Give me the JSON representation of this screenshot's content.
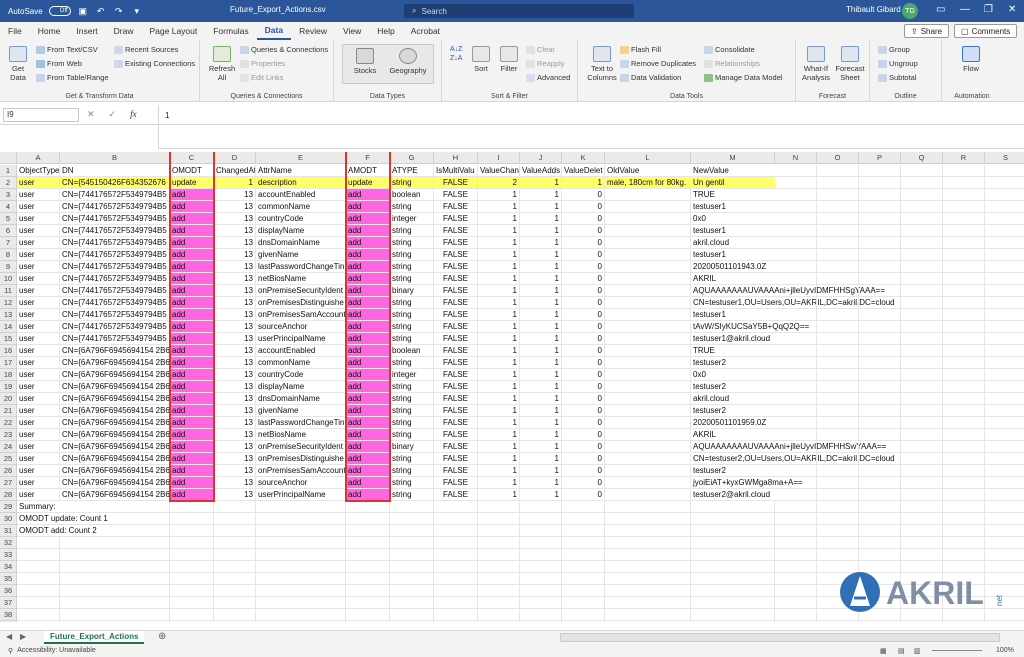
{
  "titlebar": {
    "autosave_label": "AutoSave",
    "autosave_state": "Off",
    "filename": "Future_Export_Actions.csv",
    "search_placeholder": "Search",
    "user_name": "Thibault Gibard",
    "user_initials": "TG"
  },
  "tabs": [
    "File",
    "Home",
    "Insert",
    "Draw",
    "Page Layout",
    "Formulas",
    "Data",
    "Review",
    "View",
    "Help",
    "Acrobat"
  ],
  "active_tab": "Data",
  "share_label": "Share",
  "comments_label": "Comments",
  "ribbon": {
    "get_data": "Get\nData",
    "from_text": "From Text/CSV",
    "from_web": "From Web",
    "from_table": "From Table/Range",
    "recent_sources": "Recent Sources",
    "existing_connections": "Existing Connections",
    "group1_label": "Get & Transform Data",
    "refresh_all": "Refresh\nAll",
    "queries_connections": "Queries & Connections",
    "properties": "Properties",
    "edit_links": "Edit Links",
    "group2_label": "Queries & Connections",
    "stocks": "Stocks",
    "geography": "Geography",
    "group3_label": "Data Types",
    "sort": "Sort",
    "filter": "Filter",
    "clear": "Clear",
    "reapply": "Reapply",
    "advanced": "Advanced",
    "group4_label": "Sort & Filter",
    "text_to_columns": "Text to\nColumns",
    "flash_fill": "Flash Fill",
    "remove_duplicates": "Remove Duplicates",
    "data_validation": "Data Validation",
    "consolidate": "Consolidate",
    "relationships": "Relationships",
    "manage_data_model": "Manage Data Model",
    "group5_label": "Data Tools",
    "what_if": "What-If\nAnalysis",
    "forecast_sheet": "Forecast\nSheet",
    "group6_label": "Forecast",
    "group": "Group",
    "ungroup": "Ungroup",
    "subtotal": "Subtotal",
    "group7_label": "Outline",
    "flow": "Flow",
    "group8_label": "Automation"
  },
  "formula_bar": {
    "name_box": "I9",
    "cancel_icon": "cancel-icon",
    "enter_icon": "check-icon",
    "fx_label": "fx",
    "content": "1"
  },
  "columns": [
    "A",
    "B",
    "C",
    "D",
    "E",
    "F",
    "G",
    "H",
    "I",
    "J",
    "K",
    "L",
    "M",
    "N",
    "O",
    "P",
    "Q",
    "R",
    "S"
  ],
  "rows": [
    [
      "ObjectType",
      "DN",
      "OMODT",
      "ChangedAt",
      "AttrName",
      "AMODT",
      "ATYPE",
      "IsMultiValu",
      "ValueChang",
      "ValueAdds",
      "ValueDelet",
      "OldValue",
      "NewValue"
    ],
    [
      "user",
      "CN={545150426F634352676",
      "update",
      "1",
      "description",
      "update",
      "string",
      "FALSE",
      "2",
      "1",
      "1",
      "male, 180cm for 80kg.",
      "Un gentil"
    ],
    [
      "user",
      "CN={744176572F5349794B5",
      "add",
      "13",
      "accountEnabled",
      "add",
      "boolean",
      "FALSE",
      "1",
      "1",
      "0",
      "",
      "TRUE"
    ],
    [
      "user",
      "CN={744176572F5349794B5",
      "add",
      "13",
      "commonName",
      "add",
      "string",
      "FALSE",
      "1",
      "1",
      "0",
      "",
      "testuser1"
    ],
    [
      "user",
      "CN={744176572F5349794B5",
      "add",
      "13",
      "countryCode",
      "add",
      "integer",
      "FALSE",
      "1",
      "1",
      "0",
      "",
      "0x0"
    ],
    [
      "user",
      "CN={744176572F5349794B5",
      "add",
      "13",
      "displayName",
      "add",
      "string",
      "FALSE",
      "1",
      "1",
      "0",
      "",
      "testuser1"
    ],
    [
      "user",
      "CN={744176572F5349794B5",
      "add",
      "13",
      "dnsDomainName",
      "add",
      "string",
      "FALSE",
      "1",
      "1",
      "0",
      "",
      "akril.cloud"
    ],
    [
      "user",
      "CN={744176572F5349794B5",
      "add",
      "13",
      "givenName",
      "add",
      "string",
      "FALSE",
      "1",
      "1",
      "0",
      "",
      "testuser1"
    ],
    [
      "user",
      "CN={744176572F5349794B5",
      "add",
      "13",
      "lastPasswordChangeTin",
      "add",
      "string",
      "FALSE",
      "1",
      "1",
      "0",
      "",
      "20200501101943.0Z"
    ],
    [
      "user",
      "CN={744176572F5349794B5",
      "add",
      "13",
      "netBiosName",
      "add",
      "string",
      "FALSE",
      "1",
      "1",
      "0",
      "",
      "AKRIL"
    ],
    [
      "user",
      "CN={744176572F5349794B5",
      "add",
      "13",
      "onPremiseSecurityIdent",
      "add",
      "binary",
      "FALSE",
      "1",
      "1",
      "0",
      "",
      "AQUAAAAAAAUVAAAAni+jlleUyvIDMFHHSgYAAA=="
    ],
    [
      "user",
      "CN={744176572F5349794B5",
      "add",
      "13",
      "onPremisesDistinguishe",
      "add",
      "string",
      "FALSE",
      "1",
      "1",
      "0",
      "",
      "CN=testuser1,OU=Users,OU=AKRIL,DC=akril,DC=cloud"
    ],
    [
      "user",
      "CN={744176572F5349794B5",
      "add",
      "13",
      "onPremisesSamAccount",
      "add",
      "string",
      "FALSE",
      "1",
      "1",
      "0",
      "",
      "testuser1"
    ],
    [
      "user",
      "CN={744176572F5349794B5",
      "add",
      "13",
      "sourceAnchor",
      "add",
      "string",
      "FALSE",
      "1",
      "1",
      "0",
      "",
      "tAvW/SIyKUCSaY5B+QqQ2Q=="
    ],
    [
      "user",
      "CN={744176572F5349794B5",
      "add",
      "13",
      "userPrincipalName",
      "add",
      "string",
      "FALSE",
      "1",
      "1",
      "0",
      "",
      "testuser1@akril.cloud"
    ],
    [
      "user",
      "CN={6A796F6945694154 2B6",
      "add",
      "13",
      "accountEnabled",
      "add",
      "boolean",
      "FALSE",
      "1",
      "1",
      "0",
      "",
      "TRUE"
    ],
    [
      "user",
      "CN={6A796F6945694154 2B6",
      "add",
      "13",
      "commonName",
      "add",
      "string",
      "FALSE",
      "1",
      "1",
      "0",
      "",
      "testuser2"
    ],
    [
      "user",
      "CN={6A796F6945694154 2B6",
      "add",
      "13",
      "countryCode",
      "add",
      "integer",
      "FALSE",
      "1",
      "1",
      "0",
      "",
      "0x0"
    ],
    [
      "user",
      "CN={6A796F6945694154 2B6",
      "add",
      "13",
      "displayName",
      "add",
      "string",
      "FALSE",
      "1",
      "1",
      "0",
      "",
      "testuser2"
    ],
    [
      "user",
      "CN={6A796F6945694154 2B6",
      "add",
      "13",
      "dnsDomainName",
      "add",
      "string",
      "FALSE",
      "1",
      "1",
      "0",
      "",
      "akril.cloud"
    ],
    [
      "user",
      "CN={6A796F6945694154 2B6",
      "add",
      "13",
      "givenName",
      "add",
      "string",
      "FALSE",
      "1",
      "1",
      "0",
      "",
      "testuser2"
    ],
    [
      "user",
      "CN={6A796F6945694154 2B6",
      "add",
      "13",
      "lastPasswordChangeTin",
      "add",
      "string",
      "FALSE",
      "1",
      "1",
      "0",
      "",
      "20200501101959.0Z"
    ],
    [
      "user",
      "CN={6A796F6945694154 2B6",
      "add",
      "13",
      "netBiosName",
      "add",
      "string",
      "FALSE",
      "1",
      "1",
      "0",
      "",
      "AKRIL"
    ],
    [
      "user",
      "CN={6A796F6945694154 2B6",
      "add",
      "13",
      "onPremiseSecurityIdent",
      "add",
      "binary",
      "FALSE",
      "1",
      "1",
      "0",
      "",
      "AQUAAAAAAAUVAAAAni+jlleUyvIDMFHHSwYAAA=="
    ],
    [
      "user",
      "CN={6A796F6945694154 2B6",
      "add",
      "13",
      "onPremisesDistinguishe",
      "add",
      "string",
      "FALSE",
      "1",
      "1",
      "0",
      "",
      "CN=testuser2,OU=Users,OU=AKRIL,DC=akril,DC=cloud"
    ],
    [
      "user",
      "CN={6A796F6945694154 2B6",
      "add",
      "13",
      "onPremisesSamAccount",
      "add",
      "string",
      "FALSE",
      "1",
      "1",
      "0",
      "",
      "testuser2"
    ],
    [
      "user",
      "CN={6A796F6945694154 2B6",
      "add",
      "13",
      "sourceAnchor",
      "add",
      "string",
      "FALSE",
      "1",
      "1",
      "0",
      "",
      "jyoiEiAT+kyxGWMga8ma+A=="
    ],
    [
      "user",
      "CN={6A796F6945694154 2B6",
      "add",
      "13",
      "userPrincipalName",
      "add",
      "string",
      "FALSE",
      "1",
      "1",
      "0",
      "",
      "testuser2@akril.cloud"
    ],
    [
      "Summary:"
    ],
    [
      "OMODT update: Count 1"
    ],
    [
      "OMODT add: Count 2"
    ]
  ],
  "total_rows": 40,
  "sheet_tab": "Future_Export_Actions",
  "status": {
    "accessibility": "Accessibility: Unavailable",
    "zoom": "100%"
  },
  "logo_text": "AKRIL",
  "logo_suffix": "net",
  "colors": {
    "title_bar": "#2b579a",
    "highlight_yellow": "#ffff66",
    "highlight_pink": "#ff66e0",
    "red_box": "#e0342b",
    "sheet_green": "#217346"
  }
}
